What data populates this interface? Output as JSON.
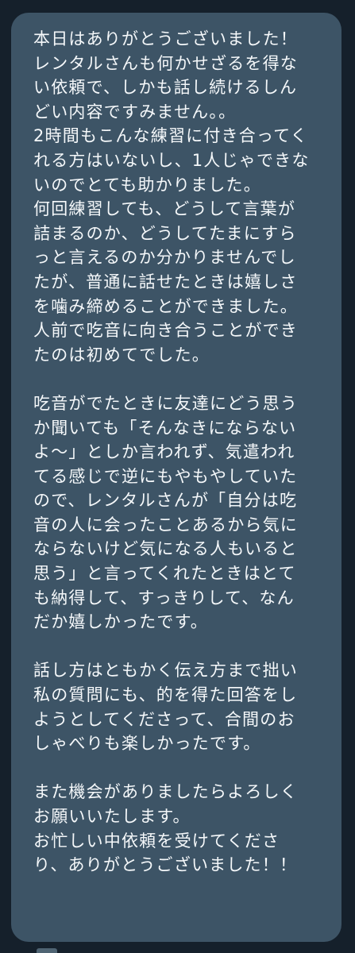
{
  "conversation": {
    "message_paragraphs": [
      "本日はありがとうございました！\nレンタルさんも何かせざるを得な\nい依頼で、しかも話し続けるしん\nどい内容ですみません。。\n2時間もこんな練習に付き合ってく\nれる方はいないし、1人じゃできな\nいのでとても助かりました。\n何回練習しても、どうして言葉が\n詰まるのか、どうしてたまにすら\nっと言えるのか分かりませんでし\nたが、普通に話せたときは嬉しさ\nを噛み締めることができました。\n人前で吃音に向き合うことができ\nたのは初めてでした。",
      "吃音がでたときに友達にどう思う\nか聞いても「そんなきにならない\nよ〜」としか言われず、気遣われ\nてる感じで逆にもやもやしていた\nので、レンタルさんが「自分は吃\n音の人に会ったことあるから気に\nならないけど気になる人もいると\n思う」と言ってくれたときはとて\nも納得して、すっきりして、なん\nだか嬉しかったです。",
      "話し方はともかく伝え方まで拙い\n私の質問にも、的を得た回答をし\nようとしてくださって、合間のお\nしゃべりも楽しかったです。",
      "また機会がありましたらよろしく\nお願いいたします。\nお忙しい中依頼を受けてくださ\nり、ありがとうございました！！"
    ]
  },
  "colors": {
    "background": "#15202b",
    "bubble": "#3d5466",
    "text": "#f5f8fa"
  }
}
